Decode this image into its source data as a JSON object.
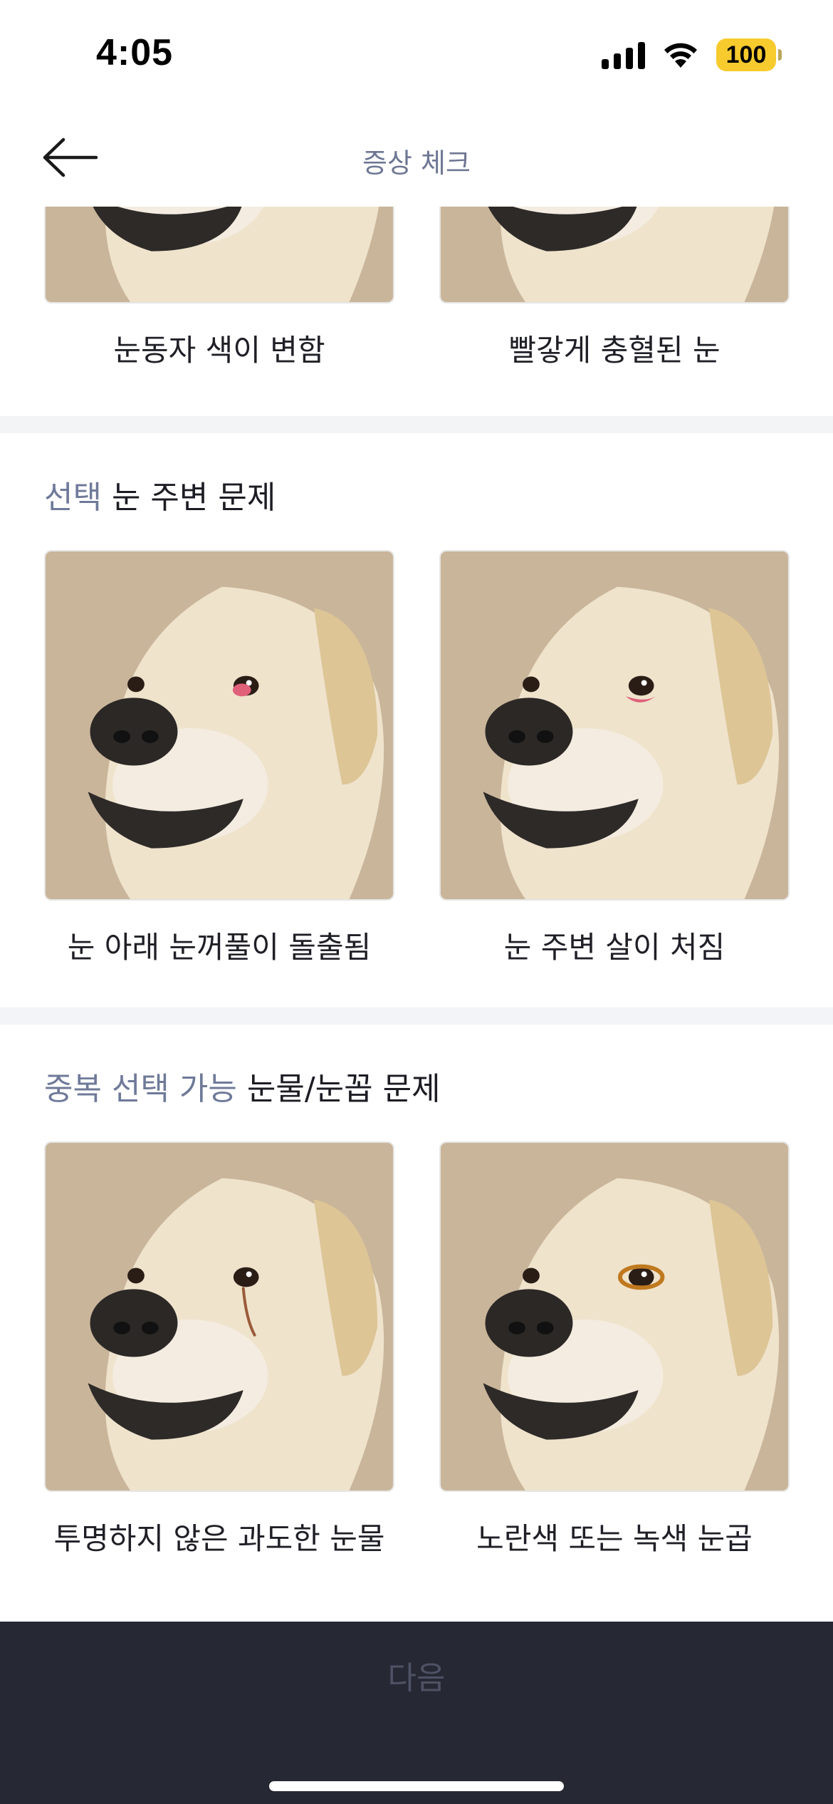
{
  "status": {
    "time": "4:05",
    "battery": "100"
  },
  "nav": {
    "title": "증상 체크"
  },
  "sections": [
    {
      "tag": "",
      "label": "",
      "options": [
        {
          "label": "눈동자 색이 변함",
          "variant": "cropped"
        },
        {
          "label": "빨갛게 충혈된 눈",
          "variant": "cropped"
        }
      ]
    },
    {
      "tag": "선택",
      "label": "눈 주변 문제",
      "options": [
        {
          "label": "눈 아래 눈꺼풀이 돌출됨",
          "variant": "cherry-eye"
        },
        {
          "label": "눈 주변 살이 처짐",
          "variant": "droopy-lid"
        }
      ]
    },
    {
      "tag": "중복 선택 가능",
      "label": "눈물/눈꼽 문제",
      "options": [
        {
          "label": "투명하지 않은 과도한 눈물",
          "variant": "tear-stain"
        },
        {
          "label": "노란색 또는 녹색 눈곱",
          "variant": "eye-discharge"
        }
      ]
    }
  ],
  "footer": {
    "next_label": "다음"
  },
  "colors": {
    "accent_tag": "#6f7a99",
    "footer_bg": "#262834",
    "battery": "#f7cb2d",
    "photo_bg": "#c9b59a",
    "fur": "#efe3cc"
  }
}
